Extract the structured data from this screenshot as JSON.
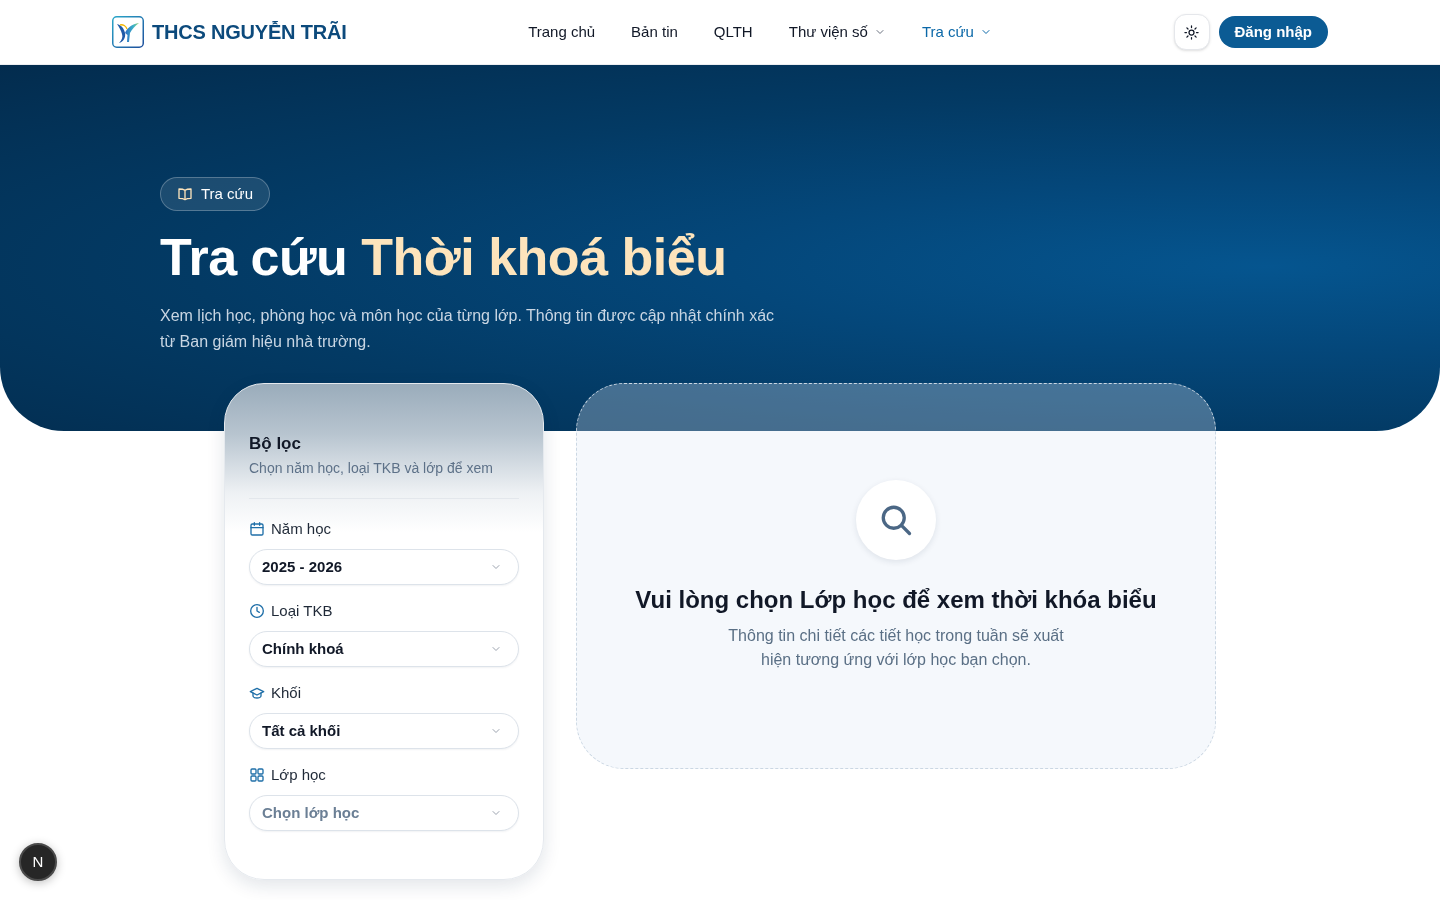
{
  "header": {
    "brand": "THCS NGUYỄN TRÃI",
    "nav": [
      {
        "label": "Trang chủ",
        "selected": false,
        "dropdown": false
      },
      {
        "label": "Bản tin",
        "selected": false,
        "dropdown": false
      },
      {
        "label": "QLTH",
        "selected": false,
        "dropdown": false
      },
      {
        "label": "Thư viện số",
        "selected": false,
        "dropdown": true
      },
      {
        "label": "Tra cứu",
        "selected": true,
        "dropdown": true
      }
    ],
    "login_button": "Đăng nhập"
  },
  "hero": {
    "badge": "Tra cứu",
    "title": "Tra cứu",
    "title_highlight": "Thời khoá biểu",
    "description": "Xem lịch học, phòng học và môn học của từng lớp. Thông tin được cập nhật chính xác từ Ban giám hiệu nhà trường."
  },
  "filter": {
    "title": "Bộ lọc",
    "subtitle": "Chọn năm học, loại TKB và lớp để xem",
    "fields": [
      {
        "label": "Năm học",
        "value": "2025 - 2026"
      },
      {
        "label": "Loại TKB",
        "value": "Chính khoá"
      },
      {
        "label": "Khối",
        "value": "Tất cả khối"
      },
      {
        "label": "Lớp học",
        "placeholder": "Chọn lớp học"
      }
    ]
  },
  "empty_state": {
    "title": "Vui lòng chọn Lớp học để xem thời khóa biểu",
    "description": "Thông tin chi tiết các tiết học trong tuần sẽ xuất hiện tương ứng với lớp học bạn chọn."
  },
  "dev_indicator": "N"
}
